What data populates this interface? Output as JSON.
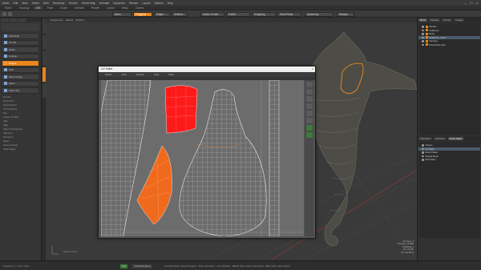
{
  "app": {
    "menu": [
      "Modo",
      "Edit",
      "View",
      "Select",
      "Item",
      "Geometry",
      "Texture",
      "Vertex Map",
      "Animate",
      "Dynamics",
      "Render",
      "Layout",
      "System",
      "Help"
    ]
  },
  "modes": [
    "Model",
    "Topology",
    "UV",
    "Paint",
    "Sculpt",
    "Animate",
    "Render",
    "Layout",
    "Setup",
    "Games"
  ],
  "toolbar": {
    "items_label": "Items",
    "polygons_label": "Polygons",
    "edges_label": "Edges",
    "vertices_label": "Vertices",
    "action_center_label": "Action Center",
    "falloff_label": "Falloff",
    "snapping_label": "Snapping",
    "work_plane_label": "Work Plane",
    "symmetry_label": "Symmetry",
    "stamps_label": "Stamps"
  },
  "left_panel": {
    "buttons": [
      {
        "label": "Add Shelf",
        "active": false
      },
      {
        "label": "UV Fill",
        "active": false
      },
      {
        "label": "Relax",
        "active": false
      },
      {
        "label": "Unwrap",
        "active": false
      },
      {
        "label": "Project",
        "active": true
      },
      {
        "label": "Peel",
        "active": false
      },
      {
        "label": "Move & Sew",
        "active": false
      },
      {
        "label": "Stitch",
        "active": false
      },
      {
        "label": "Pack UVs",
        "active": false
      }
    ],
    "small_items": [
      "Fit UVs",
      "Mirror UVs",
      "Orient Pieces",
      "UV Transform",
      "Flip",
      "Create UV Map",
      "Hide",
      "Align",
      "Select Overlapping",
      "Split UVs",
      "Transform",
      "Relax",
      "Group Unwrap",
      "Stitch Edges"
    ]
  },
  "uv_window": {
    "title": "UV Editor",
    "close": "×",
    "menu": [
      "Select",
      "View",
      "Options",
      "Help",
      "Pack"
    ]
  },
  "viewport": {
    "tabs": [
      "Perspective",
      "Default",
      "Shaded"
    ],
    "camera_label": "Camera View",
    "info": [
      "UV Items: 4",
      "Polygons: 23,980",
      "Channels: 2",
      "GL: 41,006",
      "UV: 120.00 %"
    ]
  },
  "right_panel": {
    "tabs": [
      "Items",
      "Shading",
      "Groups",
      "Images"
    ],
    "items": [
      {
        "label": "Render",
        "sel": false
      },
      {
        "label": "Seahorse",
        "sel": false
      },
      {
        "label": "Body",
        "sel": false
      },
      {
        "label": "Seahorse_mesh",
        "sel": true
      },
      {
        "label": "Camera",
        "sel": false
      },
      {
        "label": "Directional Light",
        "sel": false
      }
    ],
    "tabs2": [
      "Properties",
      "Channels",
      "Vertex Maps"
    ],
    "items2": [
      "Texture",
      "UV Maps",
      "Morph Maps",
      "Weight Maps",
      "Pick Maps"
    ]
  },
  "statusbar": {
    "left": "Polygons: 0 - 0 (0) - 0 Sel",
    "hint": "Left Click Drag: Select Polygons · Shift: Add Select · Ctrl: Deselect · Middle Click: Select Connected · Right Click: Lasso Select",
    "btn1": "UVs",
    "btn2": "Command History"
  },
  "colors": {
    "accent": "#e8861b",
    "selected_island_red": "#ff1a1a",
    "selected_island_orange": "#f06a1e"
  }
}
